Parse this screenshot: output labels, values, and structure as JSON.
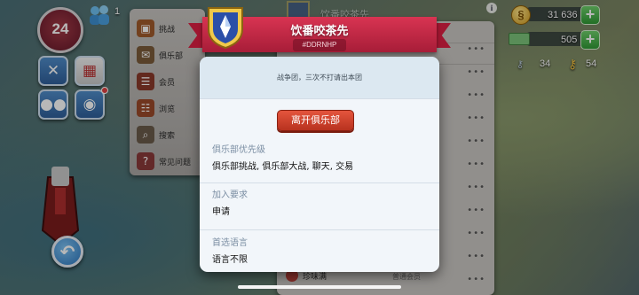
{
  "hud": {
    "level": "24",
    "population": "1",
    "resources": {
      "simoleons": "31 636",
      "simcash": "505",
      "keys_silver": "34",
      "keys_gold": "54"
    }
  },
  "side_menu": {
    "items": [
      {
        "label": "挑战",
        "icon": "challenge-icon"
      },
      {
        "label": "俱乐部",
        "icon": "club-icon"
      },
      {
        "label": "会员",
        "icon": "members-icon"
      },
      {
        "label": "浏览",
        "icon": "browse-icon"
      },
      {
        "label": "搜索",
        "icon": "search-icon"
      },
      {
        "label": "常见问题",
        "icon": "faq-icon"
      }
    ]
  },
  "background_panel": {
    "title": "饮番咬茶先",
    "footer_left": "珍味满",
    "footer_right": "普通会员"
  },
  "club_modal": {
    "name": "饮番咬茶先",
    "tag": "#DDRNHP",
    "description": "战争团，三次不打请出本团",
    "leave_button": "离开俱乐部",
    "sections": [
      {
        "label": "俱乐部优先级",
        "value": "俱乐部挑战, 俱乐部大战, 聊天, 交易"
      },
      {
        "label": "加入要求",
        "value": "申请"
      },
      {
        "label": "首选语言",
        "value": "语言不限"
      }
    ]
  },
  "colors": {
    "ribbon": "#c62a46",
    "leave_button": "#d2432c",
    "label_text": "#7b8ea3",
    "modal_bg": "#f2f6fa"
  }
}
